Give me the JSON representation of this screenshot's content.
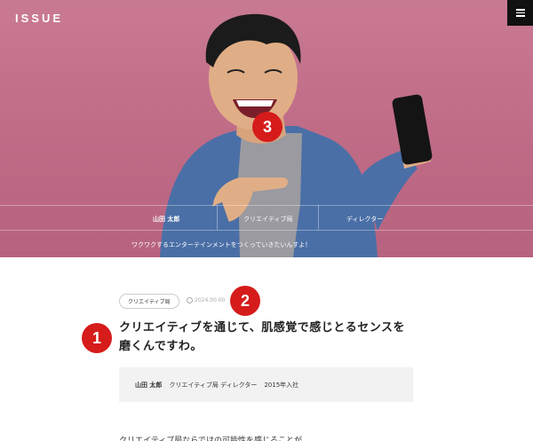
{
  "header": {
    "logo": "ISSUE",
    "menu_icon": "hamburger-icon"
  },
  "hero": {
    "name": "山田 太郎",
    "department": "クリエイティブ局",
    "role": "ディレクター",
    "catchphrase": "ワクワクするエンターテインメントをつくっていきたいんすよ！"
  },
  "annotations": {
    "badge1": "1",
    "badge2": "2",
    "badge3": "3"
  },
  "article": {
    "tag": "クリエイティブ局",
    "date": "2024.00.00",
    "title_line1": "クリエイティブを通じて、肌感覚で感じとるセンスを",
    "title_line2": "磨くんですわ。",
    "profile": {
      "name": "山田 太郎",
      "detail": "クリエイティブ局 ディレクター",
      "joined": "2015年入社"
    },
    "body_start": "クリエイティブ局ならではの可能性を感じることが……"
  },
  "colors": {
    "hero_bg": "#c07089",
    "badge": "#d61b1b",
    "profile_bg": "#f2f2f2"
  }
}
